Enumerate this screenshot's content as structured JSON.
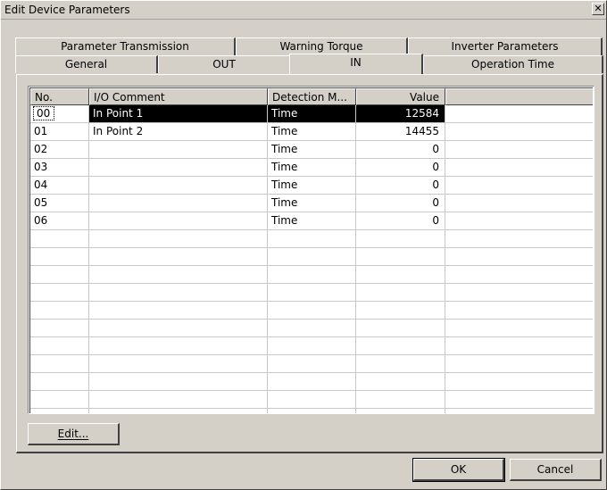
{
  "window": {
    "title": "Edit Device Parameters",
    "close_glyph": "✕"
  },
  "tabs": {
    "back_row": [
      {
        "label": "Parameter Transmission"
      },
      {
        "label": "Warning Torque"
      },
      {
        "label": "Inverter Parameters"
      }
    ],
    "front_row": [
      {
        "label": "General"
      },
      {
        "label": "OUT"
      },
      {
        "label": "IN"
      },
      {
        "label": "Operation Time"
      }
    ],
    "active": "IN"
  },
  "table": {
    "columns": [
      "No.",
      "I/O Comment",
      "Detection M...",
      "Value",
      ""
    ],
    "rows": [
      {
        "no": "00",
        "comment": "In Point 1",
        "detection": "Time",
        "value": "12584"
      },
      {
        "no": "01",
        "comment": "In Point 2",
        "detection": "Time",
        "value": "14455"
      },
      {
        "no": "02",
        "comment": "",
        "detection": "Time",
        "value": "0"
      },
      {
        "no": "03",
        "comment": "",
        "detection": "Time",
        "value": "0"
      },
      {
        "no": "04",
        "comment": "",
        "detection": "Time",
        "value": "0"
      },
      {
        "no": "05",
        "comment": "",
        "detection": "Time",
        "value": "0"
      },
      {
        "no": "06",
        "comment": "",
        "detection": "Time",
        "value": "0"
      }
    ],
    "selected_row": 0,
    "empty_rows": 11
  },
  "buttons": {
    "edit": "Edit...",
    "ok": "OK",
    "cancel": "Cancel"
  },
  "colors": {
    "face": "#d4d0c8",
    "selection": "#000000",
    "selection_text": "#ffffff"
  }
}
